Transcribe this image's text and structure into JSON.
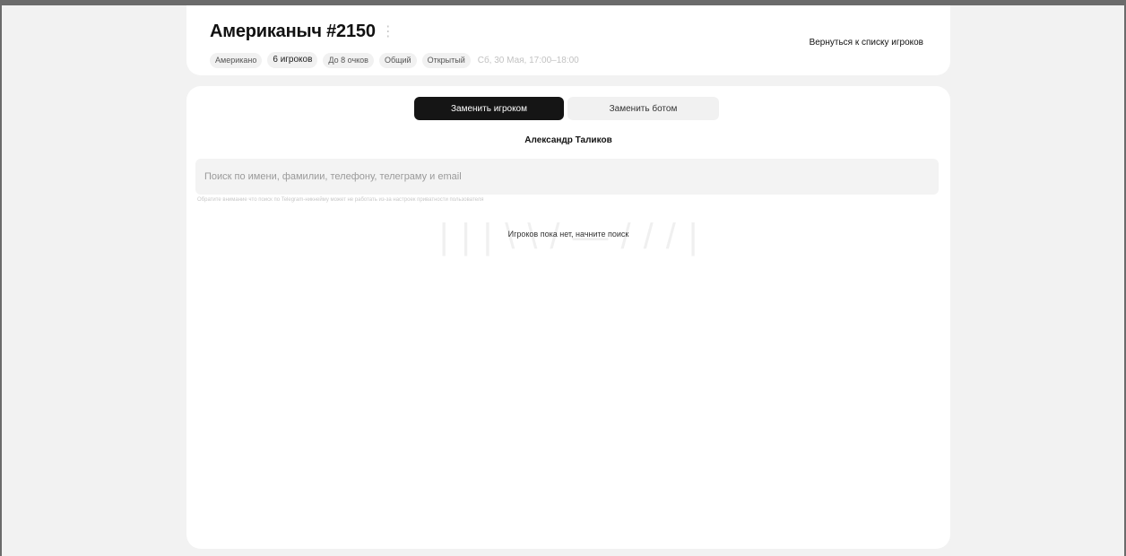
{
  "header": {
    "title": "Американыч #2150",
    "tags": [
      "Американо",
      "6 игроков",
      "До 8 очков",
      "Общий",
      "Открытый"
    ],
    "time": "Сб, 30 Мая, 17:00–18:00",
    "back_link": "Вернуться к списку игроков"
  },
  "replace": {
    "tabs": [
      "Заменить игроком",
      "Заменить ботом"
    ],
    "active_tab": "Заменить игроком",
    "player_name": "Александр Таликов"
  },
  "search": {
    "placeholder": "Поиск по имени, фамилии, телефону, телеграму и email",
    "value": "",
    "hint": "Обратите внимание что поиск по Telegram-никнейму может не работать из-за настроек приватности пользователя"
  },
  "empty_state": "Игроков пока нет, начните поиск",
  "colors": {
    "page_bg": "#f2f2f2",
    "card_bg": "#ffffff",
    "active_tab_bg": "#151515",
    "inactive_tab_bg": "#f1f1f1"
  }
}
